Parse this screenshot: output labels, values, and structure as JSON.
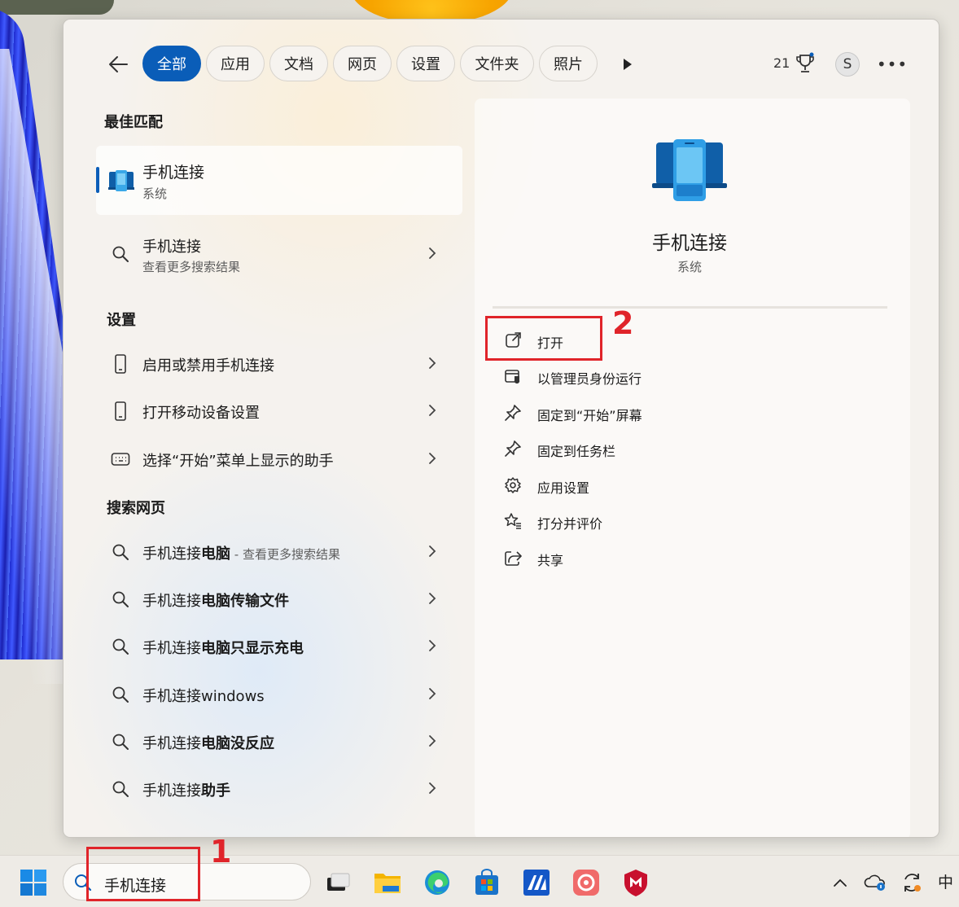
{
  "filters": {
    "back_icon": "arrow-left-icon",
    "chips": [
      "全部",
      "应用",
      "文档",
      "网页",
      "设置",
      "文件夹",
      "照片"
    ],
    "active": "全部",
    "points": "21",
    "avatar_letter": "S"
  },
  "best_match": {
    "heading": "最佳匹配",
    "title": "手机连接",
    "subtitle": "系统"
  },
  "more_results": {
    "title": "手机连接",
    "subtitle": "查看更多搜索结果"
  },
  "settings": {
    "heading": "设置",
    "items": [
      {
        "label": "启用或禁用手机连接",
        "icon": "phone-icon"
      },
      {
        "label": "打开移动设备设置",
        "icon": "phone-icon"
      },
      {
        "label": "选择“开始”菜单上显示的助手",
        "icon": "keyboard-icon"
      }
    ]
  },
  "web": {
    "heading": "搜索网页",
    "items": [
      {
        "prefix": "手机连接",
        "bold": "电脑",
        "suffix": " - 查看更多搜索结果"
      },
      {
        "prefix": "手机连接",
        "bold": "电脑传输文件",
        "suffix": ""
      },
      {
        "prefix": "手机连接",
        "bold": "电脑只显示充电",
        "suffix": ""
      },
      {
        "prefix": "手机连接",
        "bold": "windows",
        "suffix": ""
      },
      {
        "prefix": "手机连接",
        "bold": "电脑没反应",
        "suffix": ""
      },
      {
        "prefix": "手机连接",
        "bold": "助手",
        "suffix": ""
      }
    ]
  },
  "preview": {
    "title": "手机连接",
    "subtitle": "系统",
    "actions": [
      {
        "label": "打开",
        "icon": "open-external-icon"
      },
      {
        "label": "以管理员身份运行",
        "icon": "admin-shield-icon"
      },
      {
        "label": "固定到“开始”屏幕",
        "icon": "pin-icon"
      },
      {
        "label": "固定到任务栏",
        "icon": "pin-icon"
      },
      {
        "label": "应用设置",
        "icon": "gear-icon"
      },
      {
        "label": "打分并评价",
        "icon": "star-rate-icon"
      },
      {
        "label": "共享",
        "icon": "share-icon"
      }
    ]
  },
  "annotations": {
    "one": "1",
    "two": "2",
    "color": "#e0242a"
  },
  "taskbar": {
    "search_value": "手机连接",
    "ime": "中"
  },
  "colors": {
    "accent": "#0a5db8"
  }
}
